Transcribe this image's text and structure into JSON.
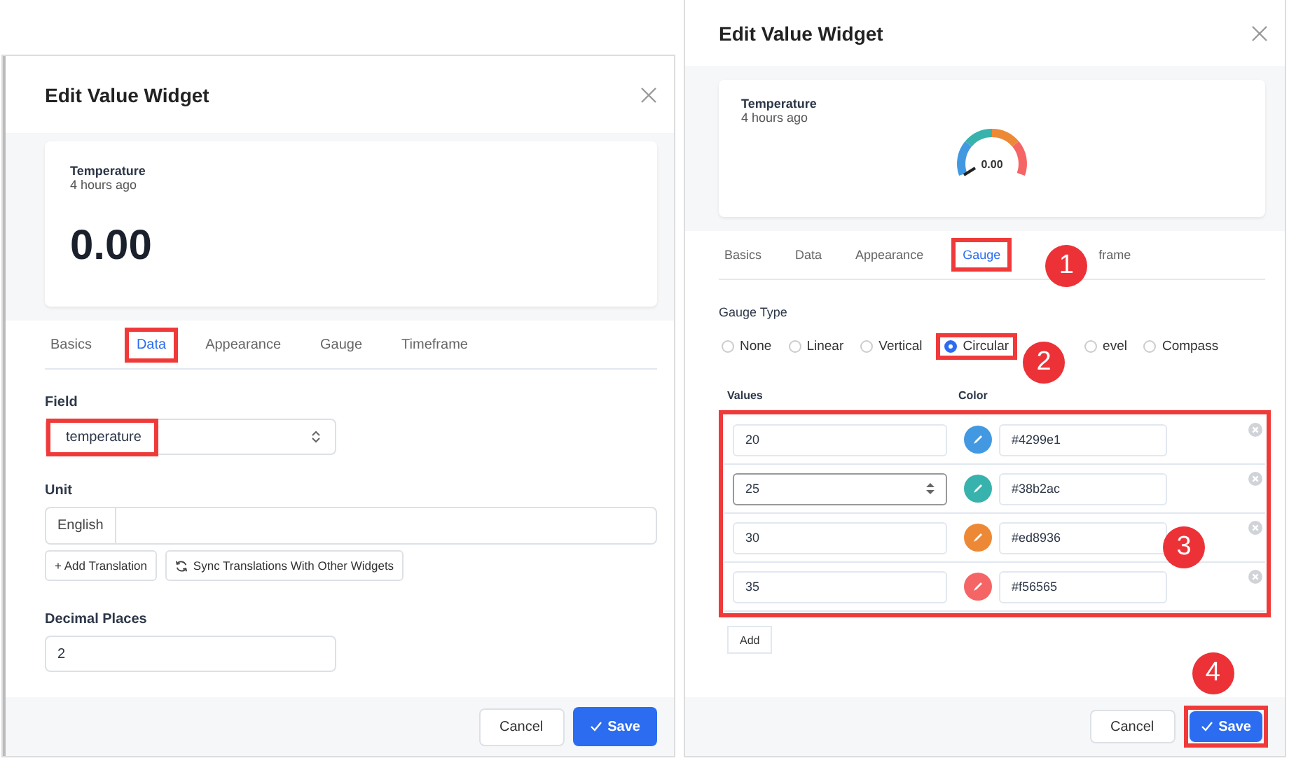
{
  "dialogs": [
    {
      "title": "Edit Value Widget",
      "preview": {
        "kind": "value",
        "name": "Temperature",
        "time": "4 hours ago",
        "value": "0.00"
      },
      "tabs": [
        {
          "label": "Basics",
          "selected": false,
          "highlighted": false
        },
        {
          "label": "Data",
          "selected": true,
          "highlighted": true
        },
        {
          "label": "Appearance",
          "selected": false,
          "highlighted": false
        },
        {
          "label": "Gauge",
          "selected": false,
          "highlighted": false
        },
        {
          "label": "Timeframe",
          "selected": false,
          "highlighted": false
        }
      ],
      "content": {
        "kind": "data",
        "field": {
          "label": "Field",
          "value": "temperature",
          "highlighted": true
        },
        "unit": {
          "label": "Unit",
          "language": "English",
          "buttons": [
            "+ Add Translation",
            "Sync Translations With Other Widgets"
          ]
        },
        "decimals": {
          "label": "Decimal Places",
          "value": "2"
        }
      },
      "footer": {
        "cancel": "Cancel",
        "save": "Save",
        "highlighted": false
      }
    },
    {
      "title": "Edit Value Widget",
      "preview": {
        "kind": "gauge",
        "name": "Temperature",
        "time": "4 hours ago",
        "value": "0.00"
      },
      "tabs": [
        {
          "label": "Basics",
          "selected": false,
          "highlighted": false
        },
        {
          "label": "Data",
          "selected": false,
          "highlighted": false
        },
        {
          "label": "Appearance",
          "selected": false,
          "highlighted": false
        },
        {
          "label": "Gauge",
          "selected": true,
          "highlighted": true,
          "badge": "1"
        },
        {
          "label": "frame",
          "selected": false,
          "highlighted": false
        }
      ],
      "content": {
        "kind": "gauge",
        "gauge_type": {
          "label": "Gauge Type",
          "options": [
            {
              "label": "None",
              "selected": false,
              "highlighted": false
            },
            {
              "label": "Linear",
              "selected": false,
              "highlighted": false
            },
            {
              "label": "Vertical",
              "selected": false,
              "highlighted": false
            },
            {
              "label": "Circular",
              "selected": true,
              "highlighted": true,
              "badge": "2"
            },
            {
              "label": "evel",
              "selected": false,
              "highlighted": false
            },
            {
              "label": "Compass",
              "selected": false,
              "highlighted": false
            }
          ]
        },
        "values_header": "Values",
        "color_header": "Color",
        "thresholds": {
          "highlighted": true,
          "badge": "3",
          "rows": [
            {
              "value": "20",
              "color": "#4299e1",
              "hex": "#4299e1",
              "focused": false
            },
            {
              "value": "25",
              "color": "#38b2ac",
              "hex": "#38b2ac",
              "focused": true
            },
            {
              "value": "30",
              "color": "#ed8936",
              "hex": "#ed8936",
              "focused": false
            },
            {
              "value": "35",
              "color": "#f56565",
              "hex": "#f56565",
              "focused": false
            }
          ]
        },
        "add": "Add"
      },
      "footer": {
        "cancel": "Cancel",
        "save": "Save",
        "highlighted": true,
        "badge": "4"
      }
    }
  ]
}
